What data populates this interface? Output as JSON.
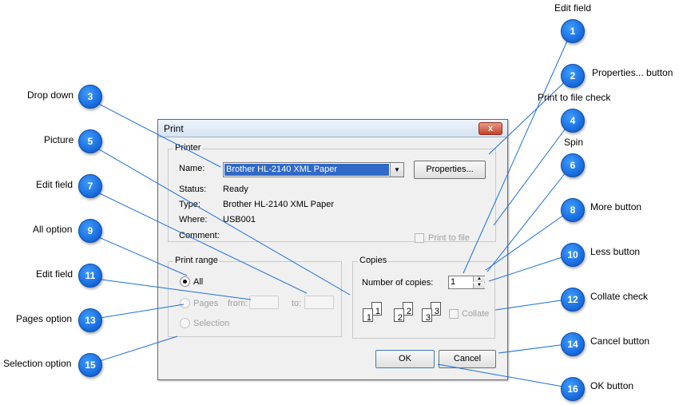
{
  "dialog": {
    "title": "Print",
    "close_label": "x",
    "printer": {
      "legend": "Printer",
      "name_label": "Name:",
      "name_value": "Brother HL-2140 XML Paper",
      "combo_arrow": "▼",
      "properties_label": "Properties...",
      "status_label": "Status:",
      "status_value": "Ready",
      "type_label": "Type:",
      "type_value": "Brother HL-2140 XML Paper",
      "where_label": "Where:",
      "where_value": "USB001",
      "comment_label": "Comment:",
      "print_to_file_label": "Print to file"
    },
    "print_range": {
      "legend": "Print range",
      "all_label": "All",
      "pages_label": "Pages",
      "from_label": "from:",
      "to_label": "to:",
      "selection_label": "Selection"
    },
    "copies": {
      "legend": "Copies",
      "number_label": "Number of copies:",
      "number_value": "1",
      "spin_up": "▲",
      "spin_down": "▼",
      "collate_label": "Collate",
      "pages": [
        {
          "back": "1",
          "front": "1"
        },
        {
          "back": "2",
          "front": "2"
        },
        {
          "back": "3",
          "front": "3"
        }
      ]
    },
    "ok_label": "OK",
    "cancel_label": "Cancel"
  },
  "annotations": [
    {
      "num": "1",
      "label": "Edit field"
    },
    {
      "num": "2",
      "label": "Properties... button"
    },
    {
      "num": "3",
      "label": "Drop down"
    },
    {
      "num": "4",
      "label": "Print to file check"
    },
    {
      "num": "5",
      "label": "Picture"
    },
    {
      "num": "6",
      "label": "Spin"
    },
    {
      "num": "7",
      "label": "Edit field"
    },
    {
      "num": "8",
      "label": "More button"
    },
    {
      "num": "9",
      "label": "All option"
    },
    {
      "num": "10",
      "label": "Less button"
    },
    {
      "num": "11",
      "label": "Edit field"
    },
    {
      "num": "12",
      "label": "Collate check"
    },
    {
      "num": "13",
      "label": "Pages option"
    },
    {
      "num": "14",
      "label": "Cancel button"
    },
    {
      "num": "15",
      "label": "Selection option"
    },
    {
      "num": "16",
      "label": "OK button"
    }
  ],
  "colors": {
    "callout": "#1a6fe0",
    "selection": "#3169c6",
    "dialog_bg": "#f0f0f0"
  }
}
